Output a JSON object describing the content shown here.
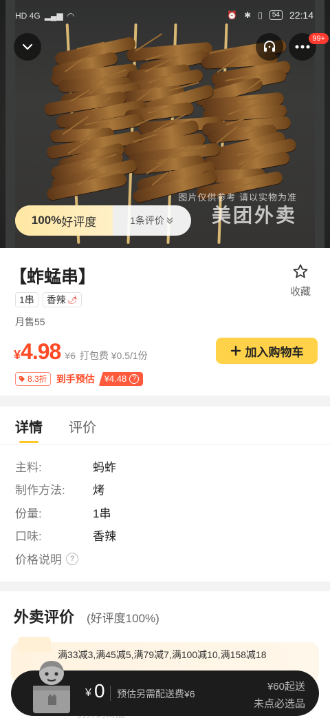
{
  "status_bar": {
    "left": "HD 4G",
    "battery": "54",
    "time": "22:14"
  },
  "hero": {
    "badge_count": "99+",
    "rating_percent": "100%",
    "rating_label": "好评度",
    "review_count": "1条评价",
    "watermark_line1": "图片仅供参考 请以实物为准",
    "watermark_line2": "美团外卖"
  },
  "product": {
    "name": "【蚱蜢串】",
    "favorite_label": "收藏",
    "tags": [
      "1串",
      "香辣"
    ],
    "monthly_sales": "月售55",
    "currency": "¥",
    "price": "4.98",
    "original_price": "¥6",
    "packing_fee": "打包费 ¥0.5/1份",
    "add_to_cart": "加入购物车",
    "discount": "8.3折",
    "estimate_label": "到手预估",
    "estimate_price": "¥4.48"
  },
  "details": {
    "tabs": [
      "详情",
      "评价"
    ],
    "attributes": [
      {
        "label": "主料:",
        "value": "蚂蚱"
      },
      {
        "label": "制作方法:",
        "value": "烤"
      },
      {
        "label": "份量:",
        "value": "1串"
      },
      {
        "label": "口味:",
        "value": "香辣"
      }
    ],
    "price_note": "价格说明"
  },
  "reviews": {
    "title": "外卖评价",
    "subtitle": "(好评度100%)",
    "promo": "满33减3,满45减5,满79减7,满100减10,满158减18",
    "faded_text": "另外的商品"
  },
  "bottom_bar": {
    "currency": "¥",
    "total": "0",
    "delivery_fee": "预估另需配送费¥6",
    "min_order": "¥60起送",
    "nothing_selected": "未点必选品"
  },
  "colors": {
    "accent": "#ffd24a",
    "price": "#ff4a26",
    "bar": "#1c1c1c"
  }
}
